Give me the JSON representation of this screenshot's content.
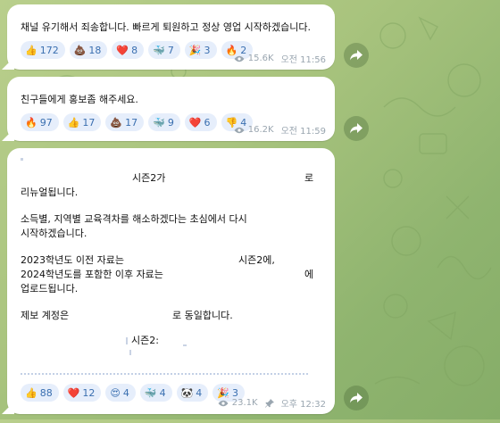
{
  "messages": [
    {
      "text": "채널 유기해서 죄송합니다. 빠르게 퇴원하고 정상 영업 시작하겠습니다.",
      "reactions": [
        {
          "emoji": "👍",
          "count": "172"
        },
        {
          "emoji": "💩",
          "count": "18"
        },
        {
          "emoji": "❤️",
          "count": "8"
        },
        {
          "emoji": "🐳",
          "count": "7"
        },
        {
          "emoji": "🎉",
          "count": "3"
        },
        {
          "emoji": "🔥",
          "count": "2"
        }
      ],
      "views": "15.6K",
      "time": "오전 11:56"
    },
    {
      "text": "친구들에게 홍보좀 해주세요.",
      "reactions": [
        {
          "emoji": "🔥",
          "count": "97"
        },
        {
          "emoji": "👍",
          "count": "17"
        },
        {
          "emoji": "💩",
          "count": "17"
        },
        {
          "emoji": "🐳",
          "count": "9"
        },
        {
          "emoji": "❤️",
          "count": "6"
        },
        {
          "emoji": "👎",
          "count": "4"
        }
      ],
      "views": "16.2K",
      "time": "오전 11:59"
    },
    {
      "lines": {
        "l1_mid": "시즌2가",
        "l1_end": "로",
        "l2": "리뉴얼됩니다.",
        "l3": "소득별, 지역별 교육격차를 해소하겠다는 초심에서 다시",
        "l4": "시작하겠습니다.",
        "l5_start": "2023학년도 이전 자료는",
        "l5_end": "시즌2에,",
        "l6_start": "2024학년도를 포함한 이후 자료는",
        "l6_end": "에",
        "l7": "업로드됩니다.",
        "l8_start": "제보 계정은",
        "l8_end": "로 동일합니다.",
        "l9": "시즌2:"
      },
      "reactions": [
        {
          "emoji": "👍",
          "count": "88"
        },
        {
          "emoji": "❤️",
          "count": "12"
        },
        {
          "emoji": "😍",
          "count": "4"
        },
        {
          "emoji": "🐳",
          "count": "4"
        },
        {
          "emoji": "🐼",
          "count": "4"
        },
        {
          "emoji": "🎉",
          "count": "3"
        }
      ],
      "views": "23.1K",
      "time": "오후 12:32"
    }
  ]
}
